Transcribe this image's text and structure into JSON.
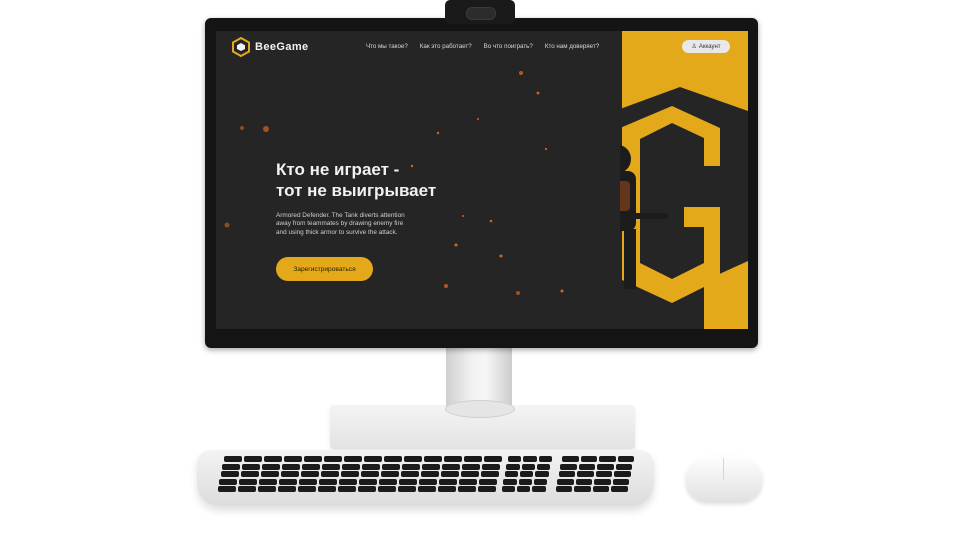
{
  "brand": {
    "name": "BeeGame",
    "accent": "#e3a91b",
    "background": "#252525"
  },
  "nav": {
    "items": [
      {
        "label": "Что мы такое?"
      },
      {
        "label": "Как это работает?"
      },
      {
        "label": "Во что поиграть?"
      },
      {
        "label": "Кто нам доверяет?"
      }
    ],
    "account_label": "Аккаунт",
    "account_icon": "user-icon"
  },
  "hero": {
    "title_line1": "Кто не играет -",
    "title_line2": "тот не выигрывает",
    "description": "Armored Defender. The Tank diverts attention away from teammates by drawing enemy fire and using thick armor to survive the attack.",
    "cta_label": "Зарегистрироваться"
  }
}
